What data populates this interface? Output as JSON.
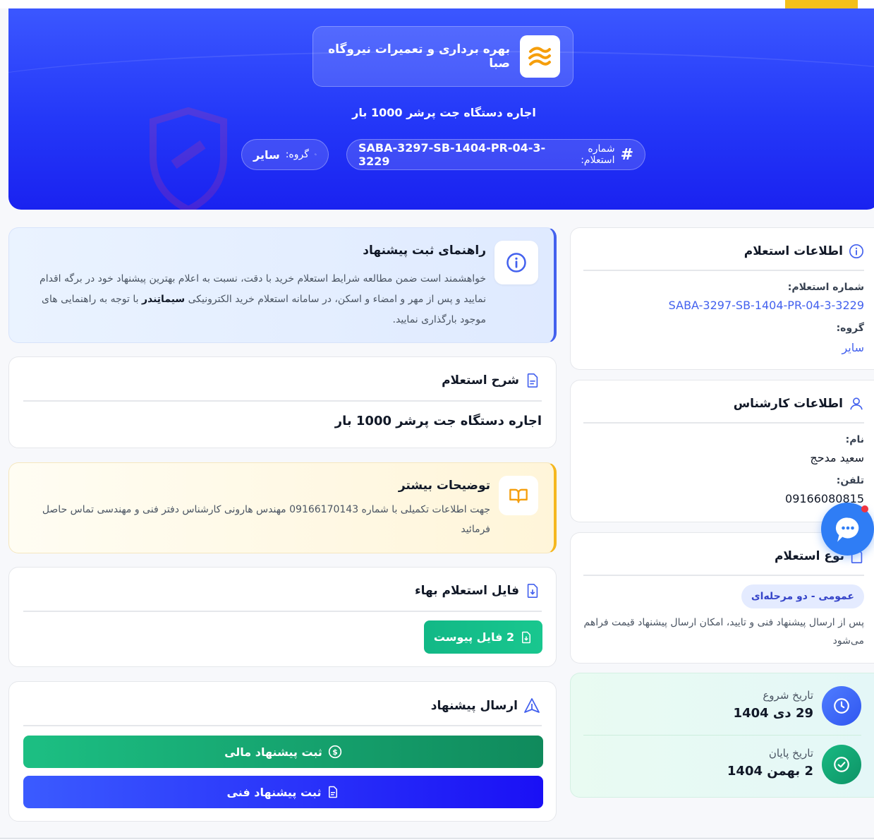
{
  "hero": {
    "company_name": "بهره برداری و تعمیرات نیروگاه صبا",
    "subtitle": "اجاره دستگاه جت پرشر 1000 بار",
    "code_label": "شماره استعلام:",
    "code_value": "SABA-3297-SB-1404-PR-04-3-3229",
    "group_label": "گروه:",
    "group_value": "سایر"
  },
  "guide": {
    "title": "راهنمای ثبت پیشنهاد",
    "text_1": "خواهشمند است ضمن مطالعه شرایط استعلام خرید با دقت، نسبت به اعلام بهترین پیشنهاد خود در برگه اقدام نمایید و پس از مهر و امضاء و اسکن، در سامانه استعلام خرید الکترونیکی ",
    "brand": "سیماتِندر",
    "text_2": " با توجه به راهنمایی های موجود بارگذاری نمایید."
  },
  "description": {
    "title": "شرح استعلام",
    "text": "اجاره دستگاه جت پرشر 1000 بار"
  },
  "extra": {
    "title": "توضیحات بیشتر",
    "text": "جهت اطلاعات تکمیلی با شماره 09166170143 مهندس هارونی کارشناس دفتر فنی و مهندسی تماس حاصل فرمائید"
  },
  "file": {
    "title": "فایل استعلام بهاء",
    "button": "2 فایل پیوست"
  },
  "submit": {
    "title": "ارسال پیشنهاد",
    "financial": "ثبت پیشنهاد مالی",
    "technical": "ثبت پیشنهاد فنی"
  },
  "info": {
    "title": "اطلاعات استعلام",
    "code_label": "شماره استعلام:",
    "code_value": "SABA-3297-SB-1404-PR-04-3-3229",
    "group_label": "گروه:",
    "group_value": "سایر"
  },
  "expert": {
    "title": "اطلاعات کارشناس",
    "name_label": "نام:",
    "name_value": "سعید مدحج",
    "phone_label": "تلفن:",
    "phone_value": "09166080815"
  },
  "type": {
    "title": "نوع استعلام",
    "badge": "عمومی - دو مرحله‌ای",
    "text": "پس از ارسال پیشنهاد فنی و تایید، امکان ارسال پیشنهاد قیمت فراهم می‌شود"
  },
  "dates": {
    "start_label": "تاریخ شروع",
    "start_value": "29 دی 1404",
    "end_label": "تاریخ پایان",
    "end_value": "2 بهمن 1404"
  },
  "colors": {
    "primary": "#2438f8",
    "accent_blue": "#4361ee",
    "green": "#12b886",
    "warning": "#f5b71f"
  }
}
